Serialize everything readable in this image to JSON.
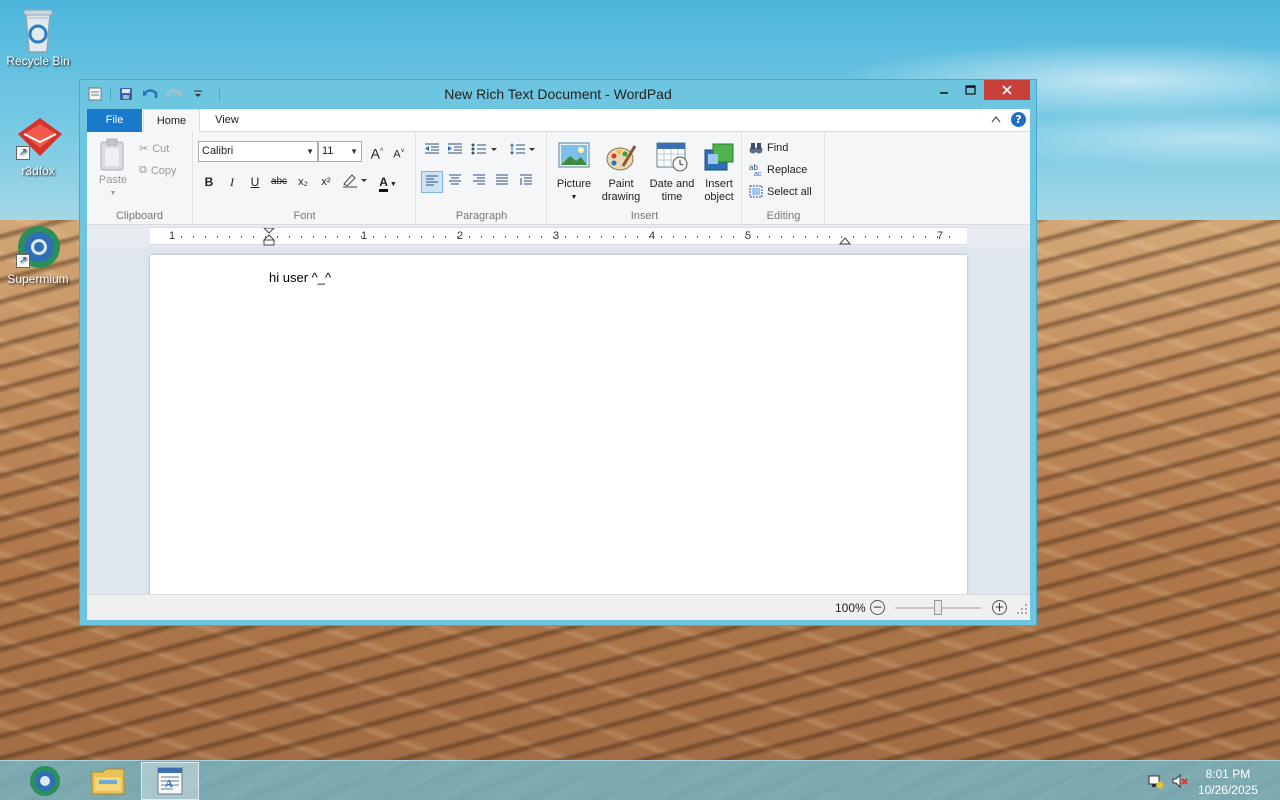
{
  "desktop": {
    "icons": [
      {
        "label": "Recycle Bin"
      },
      {
        "label": "r3dfox"
      },
      {
        "label": "Supermium"
      }
    ]
  },
  "window": {
    "title": "New Rich Text Document - WordPad",
    "tabs": {
      "file": "File",
      "home": "Home",
      "view": "View"
    },
    "clipboard": {
      "paste": "Paste",
      "cut": "Cut",
      "copy": "Copy",
      "label": "Clipboard"
    },
    "font": {
      "family": "Calibri",
      "size": "11",
      "grow": "A",
      "shrink": "A",
      "bold": "B",
      "italic": "I",
      "underline": "U",
      "strike": "abc",
      "subscript": "x₂",
      "superscript": "x²",
      "color_letter": "A",
      "label": "Font"
    },
    "paragraph": {
      "label": "Paragraph"
    },
    "insert": {
      "picture": "Picture",
      "paint_drawing_1": "Paint",
      "paint_drawing_2": "drawing",
      "date_time_1": "Date and",
      "date_time_2": "time",
      "insert_object_1": "Insert",
      "insert_object_2": "object",
      "label": "Insert"
    },
    "editing": {
      "find": "Find",
      "replace": "Replace",
      "select_all": "Select all",
      "label": "Editing"
    },
    "ruler": {
      "marks": [
        "1",
        "1",
        "2",
        "3",
        "4",
        "5",
        "7"
      ]
    },
    "document": {
      "text": "hi user ^_^"
    },
    "status": {
      "zoom": "100%",
      "zoom_level": 1.0
    }
  },
  "taskbar": {
    "time": "8:01 PM",
    "date": "10/26/2025"
  },
  "colors": {
    "file_tab": "#1979ca",
    "close_button": "#c7403a",
    "window_frame": "#6ec5e0"
  }
}
